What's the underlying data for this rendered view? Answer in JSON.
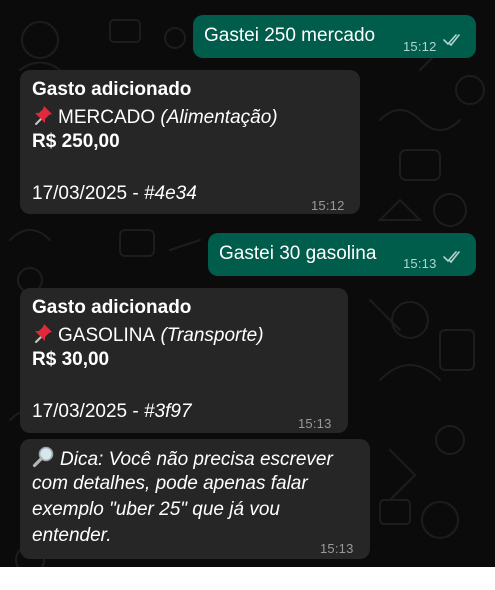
{
  "messages": [
    {
      "text": "Gastei 250 mercado",
      "time": "15:12"
    },
    {
      "title": "Gasto adicionado",
      "category": "MERCADO",
      "subcategory": "(Alimentação)",
      "amount": "R$ 250,00",
      "date_id_prefix": "17/03/2025 - ",
      "id": "#4e34",
      "time": "15:12"
    },
    {
      "text": "Gastei 30 gasolina",
      "time": "15:13"
    },
    {
      "title": "Gasto adicionado",
      "category": "GASOLINA",
      "subcategory": "(Transporte)",
      "amount": "R$ 30,00",
      "date_id_prefix": "17/03/2025 - ",
      "id": "#3f97",
      "time": "15:13"
    },
    {
      "lines": [
        "Dica: Você não precisa escrever",
        "com detalhes, pode apenas falar",
        "exemplo \"uber 25\" que já vou",
        "entender."
      ],
      "time": "15:13"
    }
  ],
  "icons": {
    "pin": "pushpin-icon",
    "tip": "magnifying-glass-icon",
    "read_receipt": "double-check-icon"
  },
  "colors": {
    "outgoing": "#005c4b",
    "incoming": "#262626",
    "background": "#0b0b0b",
    "read_ticks": "#b4d3cb"
  }
}
